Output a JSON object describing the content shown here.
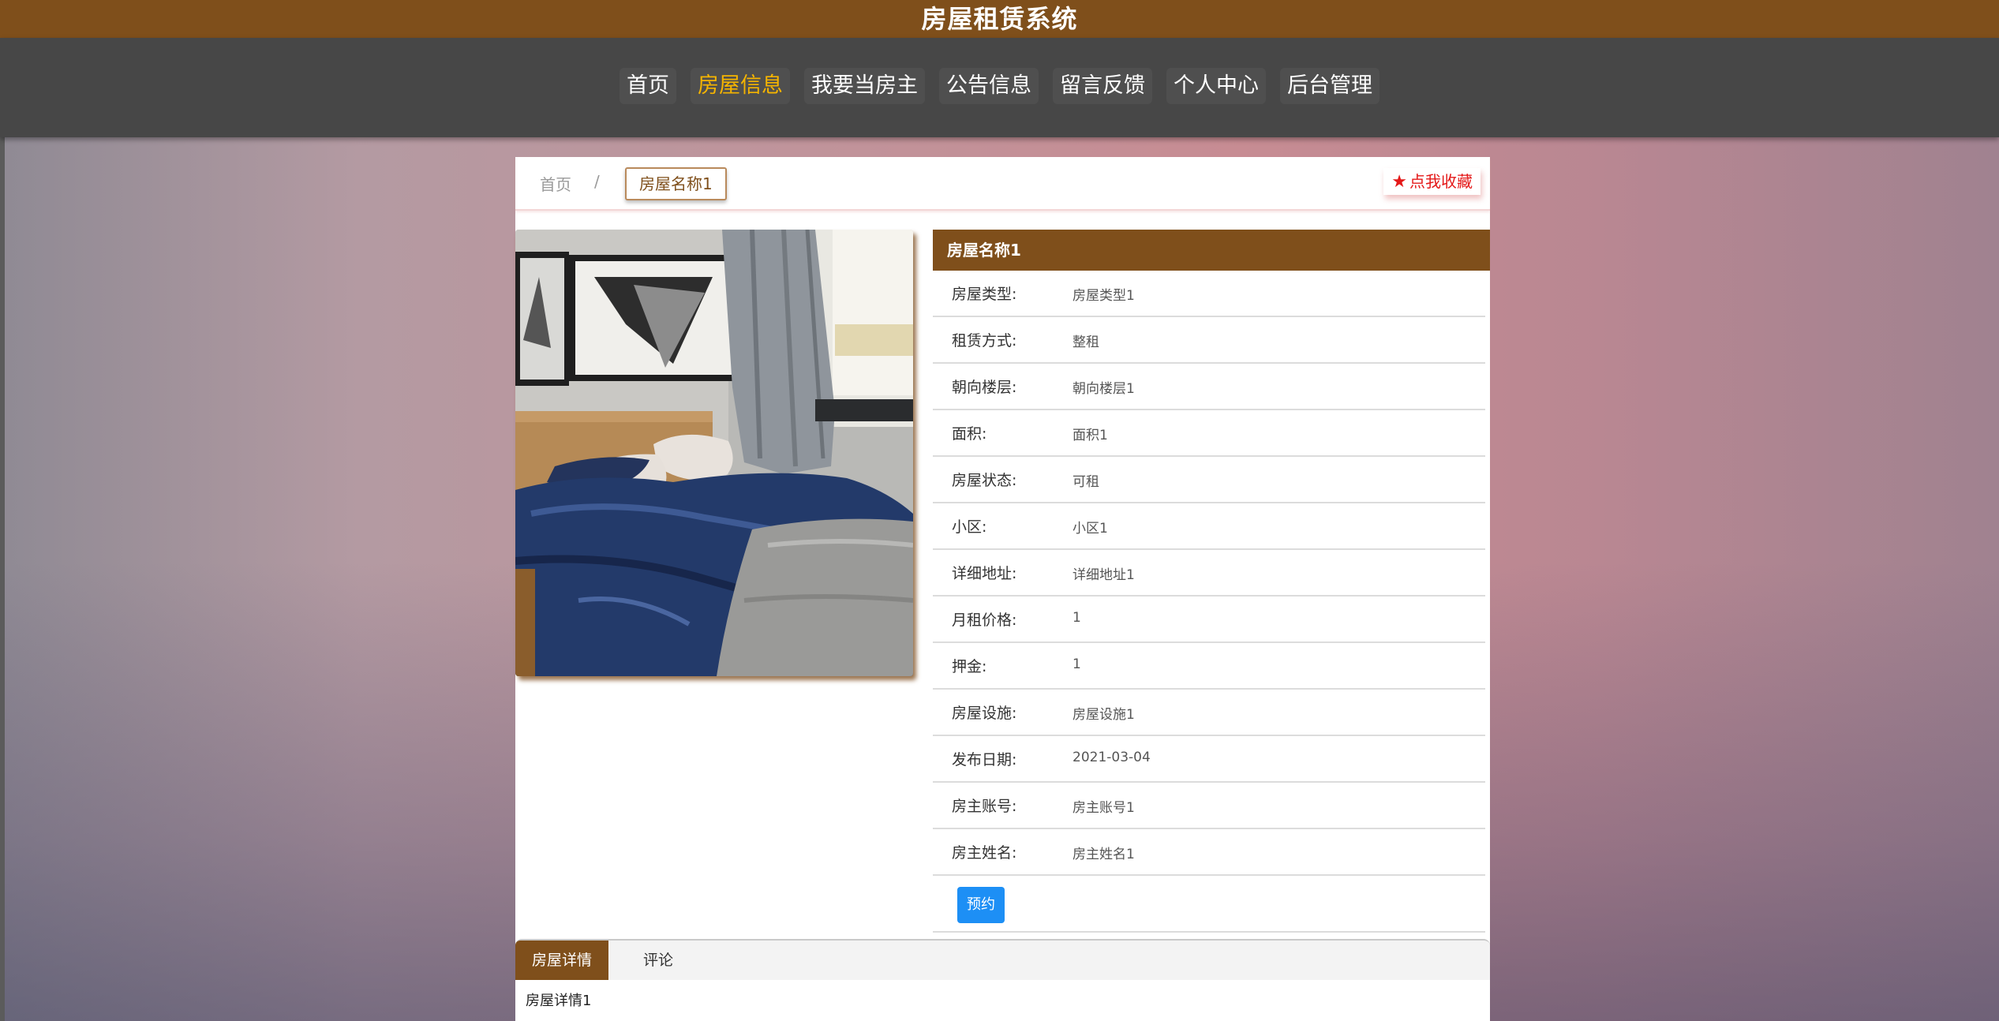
{
  "header": {
    "title": "房屋租赁系统"
  },
  "nav": {
    "items": [
      {
        "label": "首页"
      },
      {
        "label": "房屋信息",
        "active": true
      },
      {
        "label": "我要当房主"
      },
      {
        "label": "公告信息"
      },
      {
        "label": "留言反馈"
      },
      {
        "label": "个人中心"
      },
      {
        "label": "后台管理"
      }
    ],
    "active_color": "#f5b400"
  },
  "breadcrumb": {
    "home": "首页",
    "separator": "/",
    "current": "房屋名称1"
  },
  "favorite": {
    "icon": "star-icon",
    "label": "点我收藏"
  },
  "house": {
    "photo": "bedroom-photo",
    "name": "房屋名称1",
    "fields": [
      {
        "label": "房屋类型:",
        "value": "房屋类型1"
      },
      {
        "label": "租赁方式:",
        "value": "整租"
      },
      {
        "label": "朝向楼层:",
        "value": "朝向楼层1"
      },
      {
        "label": "面积:",
        "value": "面积1"
      },
      {
        "label": "房屋状态:",
        "value": "可租"
      },
      {
        "label": "小区:",
        "value": "小区1"
      },
      {
        "label": "详细地址:",
        "value": "详细地址1"
      },
      {
        "label": "月租价格:",
        "value": "1"
      },
      {
        "label": "押金:",
        "value": "1"
      },
      {
        "label": "房屋设施:",
        "value": "房屋设施1"
      },
      {
        "label": "发布日期:",
        "value": "2021-03-04"
      },
      {
        "label": "房主账号:",
        "value": "房主账号1"
      },
      {
        "label": "房主姓名:",
        "value": "房主姓名1"
      }
    ],
    "book_label": "预约"
  },
  "tabs": {
    "items": [
      {
        "label": "房屋详情",
        "active": true
      },
      {
        "label": "评论"
      }
    ],
    "content": "房屋详情1"
  },
  "colors": {
    "brand": "#7f4f1b",
    "nav_bg": "#474747",
    "button_blue": "#1d8ff5",
    "favorite_red": "#e41818"
  }
}
